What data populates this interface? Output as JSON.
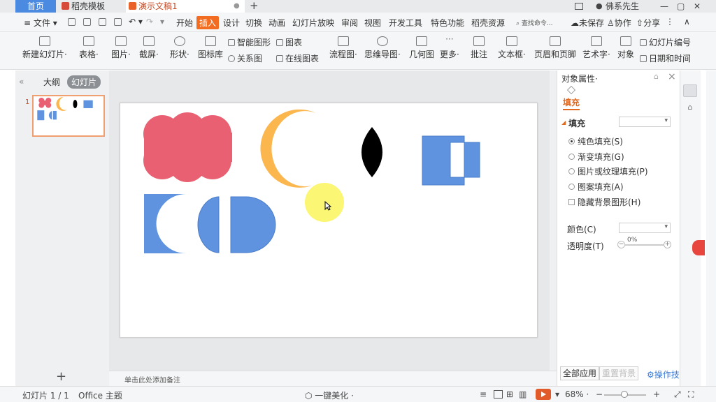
{
  "titlebar": {
    "home_tab": "首页",
    "template_tab": "稻壳模板",
    "doc_tab": "演示文稿1",
    "new_tab_icon": "plus-icon",
    "user_name": "佛系先生",
    "brand_color": "#f26d21",
    "home_color": "#4a8ae0"
  },
  "menubar": {
    "file": "文件",
    "items": [
      "开始",
      "插入",
      "设计",
      "切换",
      "动画",
      "幻灯片放映",
      "审阅",
      "视图",
      "开发工具",
      "特色功能",
      "稻壳资源"
    ],
    "active_item": "插入",
    "search_placeholder": "查找命令...",
    "unsaved": "未保存",
    "collaborate": "协作",
    "share": "分享"
  },
  "ribbon": {
    "new_slide": "新建幻灯片·",
    "table": "表格·",
    "picture": "图片·",
    "screenshot": "截屏·",
    "shape": "形状·",
    "icon_lib": "图标库",
    "smart_art": "智能图形",
    "chart": "图表",
    "relation": "关系图",
    "online_chart": "在线图表",
    "flowchart": "流程图·",
    "mindmap": "思维导图·",
    "geometry": "几何图",
    "more": "更多·",
    "comment": "批注",
    "textbox": "文本框·",
    "header_footer": "页眉和页脚",
    "wordart": "艺术字·",
    "object": "对象",
    "slide_number": "幻灯片编号",
    "date_time": "日期和时间"
  },
  "left_panel": {
    "outline_tab": "大纲",
    "slides_tab": "幻灯片",
    "slide_number": "1",
    "add_icon": "plus-icon"
  },
  "notes": {
    "placeholder": "单击此处添加备注"
  },
  "right_panel": {
    "title": "对象属性·",
    "fill_tab": "填充",
    "fill_section": "填充",
    "options": [
      "纯色填充(S)",
      "渐变填充(G)",
      "图片或纹理填充(P)",
      "图案填充(A)"
    ],
    "selected_option": "纯色填充(S)",
    "hide_bg": "隐藏背景图形(H)",
    "color_label": "颜色(C)",
    "transparency_label": "透明度(T)",
    "transparency_value": "0%",
    "apply_all": "全部应用",
    "reset_bg": "重置背景",
    "tips": "操作技",
    "accent": "#e06a22"
  },
  "statusbar": {
    "slide_info": "幻灯片 1 / 1",
    "theme": "Office 主题",
    "beautify": "一键美化 ·",
    "zoom": "68% ·"
  },
  "slide": {
    "shape_colors": {
      "cloud": "#e96072",
      "moon": "#fbb64e",
      "lens": "#000000",
      "blue": "#5f93e0"
    }
  }
}
